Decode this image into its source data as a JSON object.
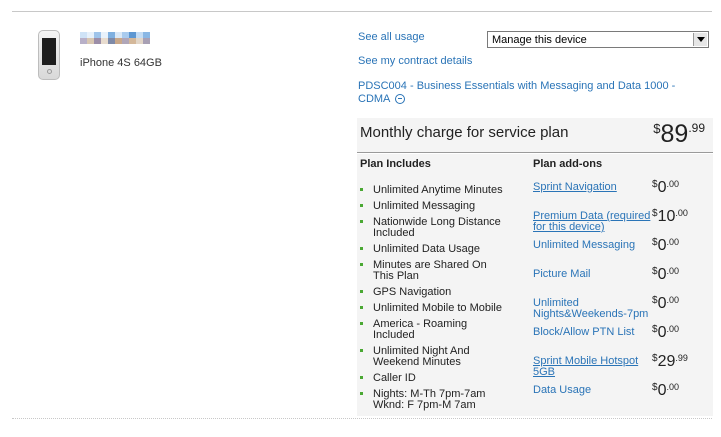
{
  "device": {
    "model": "iPhone 4S 64GB"
  },
  "links": {
    "see_all_usage": "See all usage",
    "see_contract": "See my contract details"
  },
  "manage_select": {
    "selected": "Manage this device"
  },
  "plan": {
    "description": "PDSC004 - Business Essentials with Messaging and Data 1000 - CDMA",
    "charge_label": "Monthly charge for service plan",
    "charge": {
      "currency": "$",
      "dollars": "89",
      "cents": ".99"
    }
  },
  "includes": {
    "heading": "Plan Includes",
    "items": [
      "Unlimited Anytime Minutes",
      "Unlimited Messaging",
      "Nationwide Long Distance Included",
      "Unlimited Data Usage",
      "Minutes are Shared On This Plan",
      "GPS Navigation",
      "Unlimited Mobile to Mobile",
      "America - Roaming Included",
      "Unlimited Night And Weekend Minutes",
      "Caller ID",
      "Nights: M-Th 7pm-7am Wknd: F 7pm-M 7am"
    ]
  },
  "addons": {
    "heading": "Plan add-ons",
    "items": [
      {
        "name": "Sprint Navigation",
        "linked": true,
        "currency": "$",
        "dollars": "0",
        "cents": ".00"
      },
      {
        "name": "Premium Data (required for this device)",
        "linked": true,
        "currency": "$",
        "dollars": "10",
        "cents": ".00"
      },
      {
        "name": "Unlimited Messaging",
        "linked": false,
        "currency": "$",
        "dollars": "0",
        "cents": ".00"
      },
      {
        "name": "Picture Mail",
        "linked": false,
        "currency": "$",
        "dollars": "0",
        "cents": ".00"
      },
      {
        "name": "Unlimited Nights&Weekends-7pm",
        "linked": false,
        "currency": "$",
        "dollars": "0",
        "cents": ".00"
      },
      {
        "name": "Block/Allow PTN List",
        "linked": false,
        "currency": "$",
        "dollars": "0",
        "cents": ".00"
      },
      {
        "name": "Sprint Mobile Hotspot 5GB",
        "linked": true,
        "currency": "$",
        "dollars": "29",
        "cents": ".99"
      },
      {
        "name": "Data Usage",
        "linked": false,
        "currency": "$",
        "dollars": "0",
        "cents": ".00"
      }
    ]
  },
  "colors": {
    "link": "#2a74b7",
    "bullet": "#4aa833",
    "panel_bg": "#f4f4f4"
  }
}
